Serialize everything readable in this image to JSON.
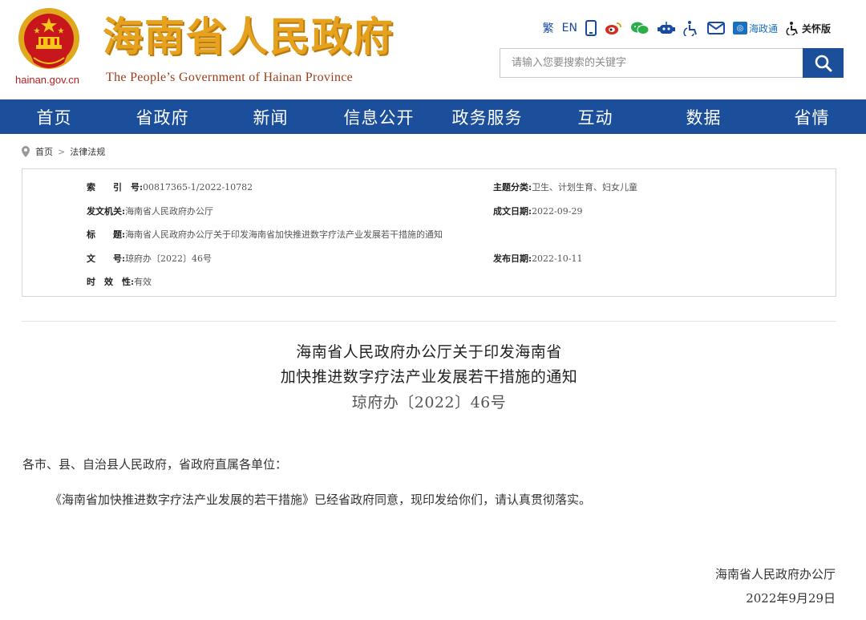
{
  "header": {
    "domain": "hainan.gov.cn",
    "site_title": "海南省人民政府",
    "site_subtitle": "The People’s Government  of Hainan Province"
  },
  "toolbar": {
    "traditional": "繁",
    "english": "EN",
    "hainantong": "海政通",
    "care_mode": "关怀版"
  },
  "search": {
    "placeholder": "请输入您要搜索的关键字"
  },
  "nav": {
    "items": [
      "首页",
      "省政府",
      "新闻",
      "信息公开",
      "政务服务",
      "互动",
      "数据",
      "省情"
    ]
  },
  "breadcrumb": {
    "home": "首页",
    "current": "法律法规"
  },
  "meta": {
    "index_label": "索　　引　号:",
    "index_value": "00817365-1/2022-10782",
    "topic_label": "主题分类:",
    "topic_value": "卫生、计划生育、妇女儿童",
    "issuer_label": "发文机关:",
    "issuer_value": "海南省人民政府办公厅",
    "created_label": "成文日期:",
    "created_value": "2022-09-29",
    "title_label": "标　　题:",
    "title_value": "海南省人民政府办公厅关于印发海南省加快推进数字疗法产业发展若干措施的通知",
    "docno_label": "文　　号:",
    "docno_value": "琼府办〔2022〕46号",
    "published_label": "发布日期:",
    "published_value": "2022-10-11",
    "validity_label": "时　效　性:",
    "validity_value": "有效"
  },
  "document": {
    "title_line1": "海南省人民政府办公厅关于印发海南省",
    "title_line2": "加快推进数字疗法产业发展若干措施的通知",
    "number": "琼府办〔2022〕46号",
    "salutation": "各市、县、自治县人民政府，省政府直属各单位：",
    "body": "《海南省加快推进数字疗法产业发展的若干措施》已经省政府同意，现印发给你们，请认真贯彻落实。",
    "signer": "海南省人民政府办公厅",
    "date": "2022年9月29日"
  },
  "colors": {
    "nav_bg": "#1b4e9b",
    "title_gold": "#e6a21e",
    "emblem_red": "#c8161d"
  }
}
